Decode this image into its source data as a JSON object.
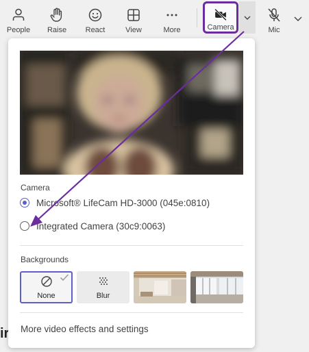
{
  "toolbar": {
    "people_label": "People",
    "raise_label": "Raise",
    "react_label": "React",
    "view_label": "View",
    "more_label": "More",
    "camera_label": "Camera",
    "mic_label": "Mic"
  },
  "panel": {
    "camera_section_label": "Camera",
    "cameras": [
      {
        "label": "Microsoft® LifeCam HD-3000 (045e:0810)",
        "selected": true
      },
      {
        "label": "Integrated Camera (30c9:0063)",
        "selected": false
      }
    ],
    "backgrounds_section_label": "Backgrounds",
    "backgrounds": [
      {
        "label": "None",
        "selected": true,
        "icon": "prohibited-icon"
      },
      {
        "label": "Blur",
        "selected": false,
        "icon": "blur-icon"
      }
    ],
    "more_settings_label": "More video effects and settings"
  },
  "page_fragment": "ir",
  "colors": {
    "accent": "#5b5fc7",
    "annotation": "#6b2d9e"
  }
}
